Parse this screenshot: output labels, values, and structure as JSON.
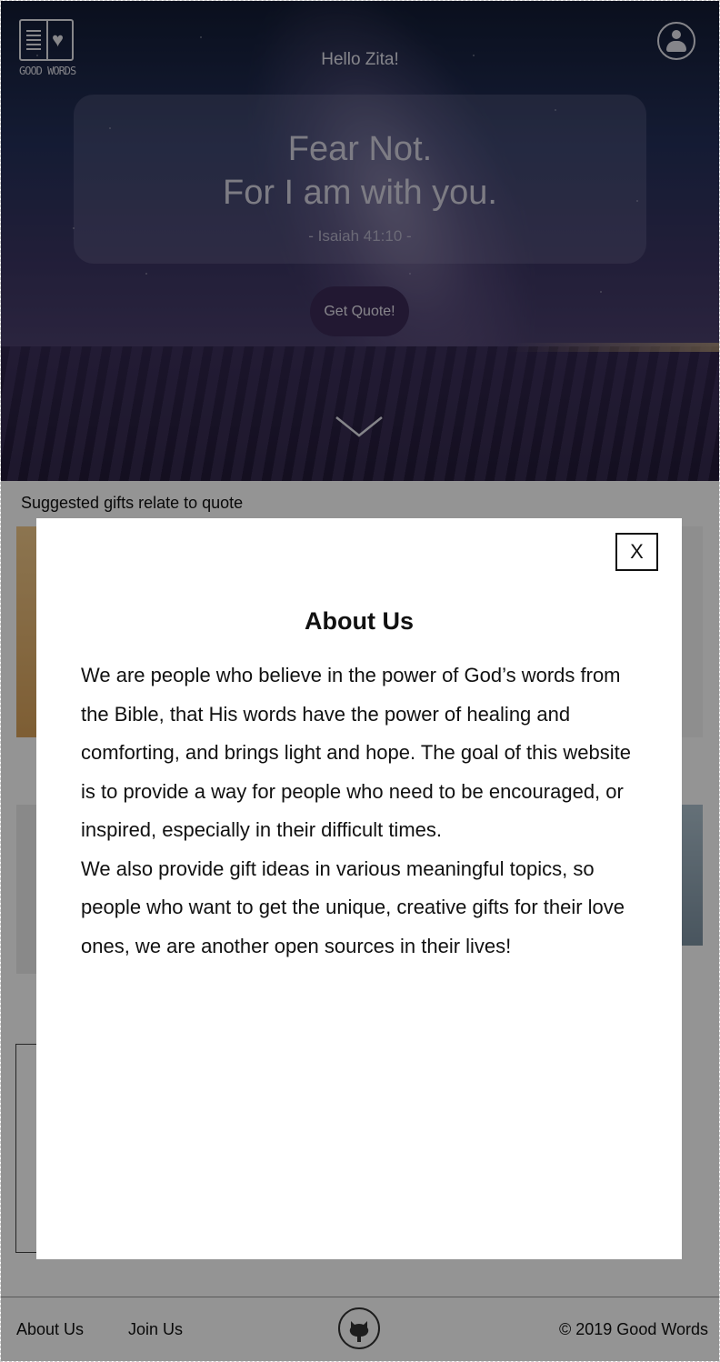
{
  "header": {
    "logo_text": "GOOD WORDS",
    "greeting": "Hello Zita!"
  },
  "quote": {
    "line1": "Fear Not.",
    "line2": "For I am with you.",
    "reference": "- Isaiah 41:10 -",
    "button_label": "Get Quote!"
  },
  "icons": {
    "logo": "book-heart-icon",
    "user": "user-avatar-icon",
    "scroll": "chevron-down-icon",
    "github": "github-icon"
  },
  "gifts": {
    "section_title": "Suggested gifts relate to quote"
  },
  "modal": {
    "close_label": "X",
    "title": "About Us",
    "paragraph1": "We are people who believe in the power of God’s words from the Bible, that His words have the power of healing and comforting, and brings light and hope. The goal of this website is to provide a way for people who need to be encouraged, or inspired, especially in their difficult times.",
    "paragraph2": "We also provide gift ideas in various meaningful topics, so people who want to get the unique, creative gifts for their love ones, we are another open sources in their lives!"
  },
  "footer": {
    "about_label": "About Us",
    "join_label": "Join Us",
    "copyright": "© 2019 Good Words"
  },
  "colors": {
    "accent": "#3b2a57",
    "overlay": "rgba(0,0,0,0.42)"
  }
}
